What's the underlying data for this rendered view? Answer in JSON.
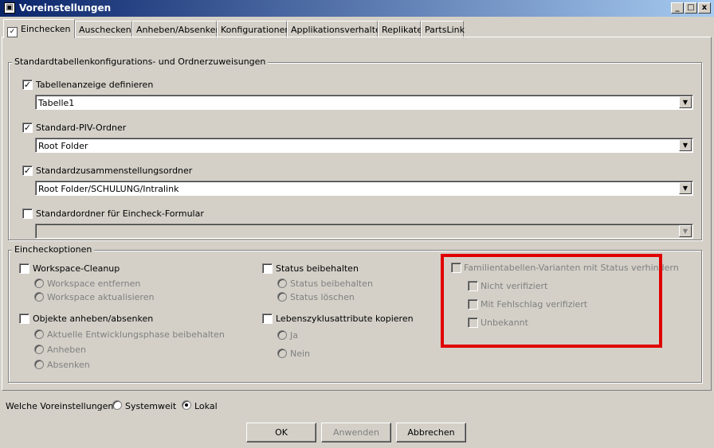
{
  "window": {
    "title": "Voreinstellungen",
    "minimize": "_",
    "maximize": "□",
    "close": "x"
  },
  "tabs": [
    {
      "label": "Einchecken",
      "active": true
    },
    {
      "label": "Auschecken"
    },
    {
      "label": "Anheben/Absenken"
    },
    {
      "label": "Konfigurationen"
    },
    {
      "label": "Applikationsverhalten"
    },
    {
      "label": "Replikate"
    },
    {
      "label": "PartsLink"
    }
  ],
  "std_group": {
    "title": "Standardtabellenkonfigurations- und Ordnerzuweisungen",
    "tabellenanzeige": {
      "label": "Tabellenanzeige definieren",
      "checked": true,
      "value": "Tabelle1"
    },
    "piv_ordner": {
      "label": "Standard-PIV-Ordner",
      "checked": true,
      "value": "Root Folder"
    },
    "zusammenstellung": {
      "label": "Standardzusammenstellungsordner",
      "checked": true,
      "value": "Root Folder/SCHULUNG/Intralink"
    },
    "eincheck_formular": {
      "label": "Standardordner für Eincheck-Formular",
      "checked": false,
      "value": ""
    }
  },
  "optionen_group": {
    "title": "Eincheckoptionen",
    "workspace": {
      "label": "Workspace-Cleanup",
      "r1": "Workspace entfernen",
      "r2": "Workspace aktualisieren"
    },
    "objekte": {
      "label": "Objekte anheben/absenken",
      "r1": "Aktuelle Entwicklungsphase beibehalten",
      "r2": "Anheben",
      "r3": "Absenken"
    },
    "status": {
      "label": "Status beibehalten",
      "r1": "Status beibehalten",
      "r2": "Status löschen"
    },
    "lebenszyklus": {
      "label": "Lebenszyklusattribute kopieren",
      "r1": "Ja",
      "r2": "Nein"
    },
    "familien": {
      "label": "Familientabellen-Varianten mit Status verhindern",
      "c1": "Nicht verifiziert",
      "c2": "Mit Fehlschlag verifiziert",
      "c3": "Unbekannt"
    }
  },
  "footer": {
    "label": "Welche Voreinstellungen:",
    "systemweit": "Systemweit",
    "lokal": "Lokal",
    "ok": "OK",
    "anwenden": "Anwenden",
    "abbrechen": "Abbrechen"
  },
  "colors": {
    "highlight": "#e00000",
    "titlebar": "#0a246a"
  },
  "check_mark": "✓"
}
